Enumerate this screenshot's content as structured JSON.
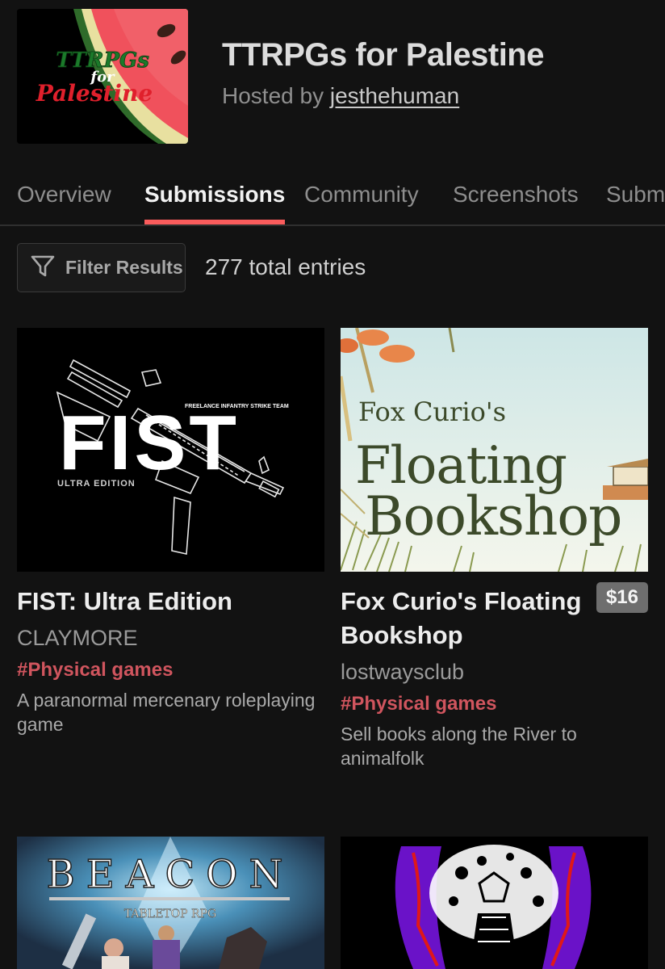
{
  "jam": {
    "title": "TTRPGs for Palestine",
    "hosted_by_prefix": "Hosted by ",
    "host": "jesthehuman",
    "cover_text": {
      "line1": "TTRPGs",
      "line2": "for",
      "line3": "Palestine"
    }
  },
  "tabs": [
    {
      "label": "Overview",
      "active": false
    },
    {
      "label": "Submissions",
      "active": true
    },
    {
      "label": "Community",
      "active": false
    },
    {
      "label": "Screenshots",
      "active": false
    },
    {
      "label": "Subm",
      "active": false
    }
  ],
  "filter": {
    "label": "Filter Results",
    "icon": "filter-icon"
  },
  "total_entries": "277 total entries",
  "accent_color": "#fa5c5c",
  "tag_color": "#d0555e",
  "games": [
    {
      "title": "FIST: Ultra Edition",
      "author": "CLAYMORE",
      "tag": "#Physical games",
      "description": "A paranormal mercenary roleplaying game",
      "price": null,
      "cover": {
        "big_text": "FIST",
        "sub_text": "ULTRA EDITION",
        "tagline": "FREELANCE INFANTRY STRIKE TEAM"
      }
    },
    {
      "title": "Fox Curio's Floating Bookshop",
      "author": "lostwaysclub",
      "tag": "#Physical games",
      "description": "Sell books along the River to animalfolk",
      "price": "$16",
      "cover": {
        "line1": "Fox Curio's",
        "line2": "Floating",
        "line3": "Bookshop"
      }
    },
    {
      "title": "",
      "author": "",
      "tag": "",
      "description": "",
      "price": null,
      "cover": {
        "big_text": "BEACON",
        "sub_text": "TABLETOP RPG"
      }
    },
    {
      "title": "",
      "author": "",
      "tag": "",
      "description": "",
      "price": null,
      "cover": {}
    }
  ]
}
